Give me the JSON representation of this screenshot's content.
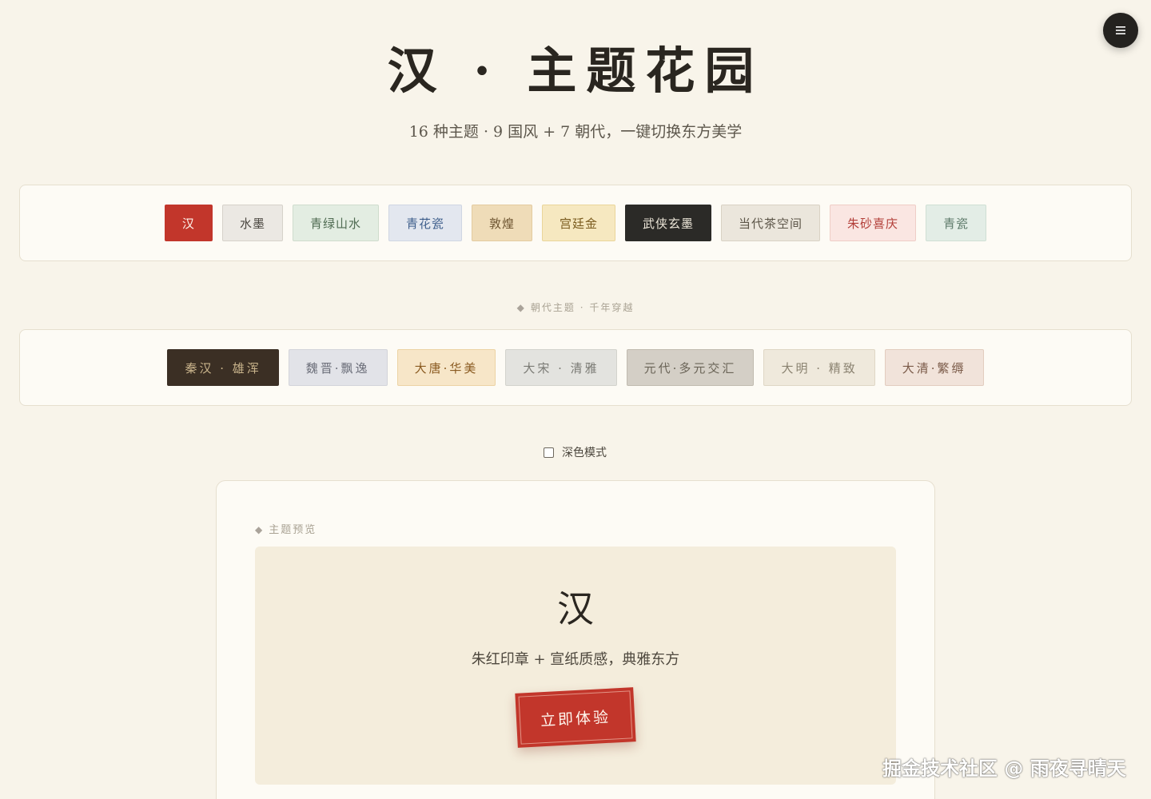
{
  "header": {
    "title": "汉 · 主题花园",
    "subtitle": "16 种主题 · 9 国风 + 7 朝代，一键切换东方美学"
  },
  "menu_button": {
    "icon": "hamburger-menu-icon"
  },
  "style_themes": [
    {
      "label": "汉",
      "bg": "#c2362b",
      "fg": "#fff6ee",
      "border": "#c2362b"
    },
    {
      "label": "水墨",
      "bg": "#ebe8e3",
      "fg": "#4a4640",
      "border": "#d6d2ca"
    },
    {
      "label": "青绿山水",
      "bg": "#e3ede2",
      "fg": "#4f6b52",
      "border": "#cfdccd"
    },
    {
      "label": "青花瓷",
      "bg": "#e3e7ef",
      "fg": "#3f5f8c",
      "border": "#cfd6e2"
    },
    {
      "label": "敦煌",
      "bg": "#efdcb8",
      "fg": "#6d5430",
      "border": "#e3cba0"
    },
    {
      "label": "宫廷金",
      "bg": "#f6e8c0",
      "fg": "#7a5b1e",
      "border": "#ead59a"
    },
    {
      "label": "武侠玄墨",
      "bg": "#2b2a27",
      "fg": "#ece6d8",
      "border": "#2b2a27"
    },
    {
      "label": "当代茶空间",
      "bg": "#ebe6dc",
      "fg": "#5c5548",
      "border": "#d9d2c4"
    },
    {
      "label": "朱砂喜庆",
      "bg": "#fae6e2",
      "fg": "#b3403a",
      "border": "#efcdc6"
    },
    {
      "label": "青瓷",
      "bg": "#e3ede6",
      "fg": "#5d7a6a",
      "border": "#cfdfd4"
    }
  ],
  "dynasty_section_label": "朝代主题 · 千年穿越",
  "dynasty_themes": [
    {
      "label": "秦汉 · 雄浑",
      "bg": "#3b2f24",
      "fg": "#c9b48c",
      "border": "#3b2f24"
    },
    {
      "label": "魏晋·飘逸",
      "bg": "#e2e3e8",
      "fg": "#6a6d78",
      "border": "#d3d4da"
    },
    {
      "label": "大唐·华美",
      "bg": "#f7e6c8",
      "fg": "#8a5a20",
      "border": "#ecd3a4"
    },
    {
      "label": "大宋 · 清雅",
      "bg": "#e3e3df",
      "fg": "#7a7a74",
      "border": "#d3d3cd"
    },
    {
      "label": "元代·多元交汇",
      "bg": "#d4cfc6",
      "fg": "#6a6457",
      "border": "#c1bbb0"
    },
    {
      "label": "大明 · 精致",
      "bg": "#efe9dc",
      "fg": "#8a8270",
      "border": "#dfd7c5"
    },
    {
      "label": "大清·繁缛",
      "bg": "#f1e3da",
      "fg": "#7a5a48",
      "border": "#e2cdbf"
    }
  ],
  "dark_mode": {
    "label": "深色模式",
    "checked": false
  },
  "preview": {
    "label": "主题预览",
    "glyph": "汉",
    "description": "朱红印章 + 宣纸质感，典雅东方",
    "cta": "立即体验"
  },
  "watermark": "掘金技术社区 @ 雨夜寻晴天"
}
